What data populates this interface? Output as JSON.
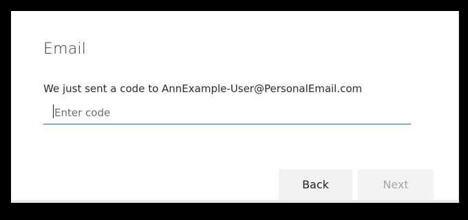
{
  "dialog": {
    "title": "Email",
    "message": "We just sent a code to AnnExample-User@PersonalEmail.com",
    "code_input": {
      "value": "",
      "placeholder": "Enter code"
    },
    "back_label": "Back",
    "next_label": "Next"
  },
  "colors": {
    "input_underline": "#0f6cbd",
    "next_disabled_text": "#a6a6a6",
    "button_background": "#f1f1f1"
  }
}
